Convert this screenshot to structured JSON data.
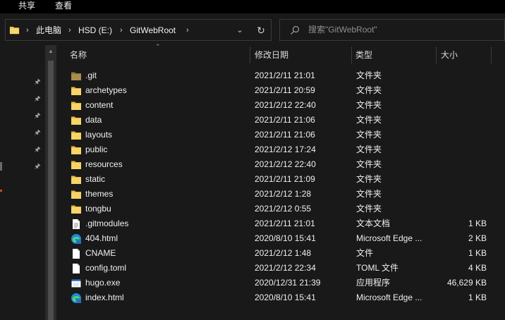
{
  "ribbon": {
    "tabs": [
      "共享",
      "查看"
    ]
  },
  "address": {
    "crumbs": [
      "此电脑",
      "HSD (E:)",
      "GitWebRoot"
    ],
    "separator": "›",
    "dropdown_icon": "chevron-down-icon",
    "refresh_icon": "refresh-icon"
  },
  "search": {
    "placeholder": "搜索\"GitWebRoot\""
  },
  "columns": {
    "name": "名称",
    "date": "修改日期",
    "type": "类型",
    "size": "大小"
  },
  "colors": {
    "folder": "#f0c24a",
    "accent_edge": "#d04a2a",
    "background": "#191919"
  },
  "files": [
    {
      "name": ".git",
      "date": "2021/2/11 21:01",
      "type": "文件夹",
      "size": "",
      "icon": "folder-icon-hidden"
    },
    {
      "name": "archetypes",
      "date": "2021/2/11 20:59",
      "type": "文件夹",
      "size": "",
      "icon": "folder-icon"
    },
    {
      "name": "content",
      "date": "2021/2/12 22:40",
      "type": "文件夹",
      "size": "",
      "icon": "folder-icon"
    },
    {
      "name": "data",
      "date": "2021/2/11 21:06",
      "type": "文件夹",
      "size": "",
      "icon": "folder-icon"
    },
    {
      "name": "layouts",
      "date": "2021/2/11 21:06",
      "type": "文件夹",
      "size": "",
      "icon": "folder-icon"
    },
    {
      "name": "public",
      "date": "2021/2/12 17:24",
      "type": "文件夹",
      "size": "",
      "icon": "folder-icon"
    },
    {
      "name": "resources",
      "date": "2021/2/12 22:40",
      "type": "文件夹",
      "size": "",
      "icon": "folder-icon"
    },
    {
      "name": "static",
      "date": "2021/2/11 21:09",
      "type": "文件夹",
      "size": "",
      "icon": "folder-icon"
    },
    {
      "name": "themes",
      "date": "2021/2/12 1:28",
      "type": "文件夹",
      "size": "",
      "icon": "folder-icon"
    },
    {
      "name": "tongbu",
      "date": "2021/2/12 0:55",
      "type": "文件夹",
      "size": "",
      "icon": "folder-icon"
    },
    {
      "name": ".gitmodules",
      "date": "2021/2/11 21:01",
      "type": "文本文档",
      "size": "1 KB",
      "icon": "text-file-icon"
    },
    {
      "name": "404.html",
      "date": "2020/8/10 15:41",
      "type": "Microsoft Edge ...",
      "size": "2 KB",
      "icon": "edge-html-icon"
    },
    {
      "name": "CNAME",
      "date": "2021/2/12 1:48",
      "type": "文件",
      "size": "1 KB",
      "icon": "blank-file-icon"
    },
    {
      "name": "config.toml",
      "date": "2021/2/12 22:34",
      "type": "TOML 文件",
      "size": "4 KB",
      "icon": "blank-file-icon"
    },
    {
      "name": "hugo.exe",
      "date": "2020/12/31 21:39",
      "type": "应用程序",
      "size": "46,629 KB",
      "icon": "exe-file-icon"
    },
    {
      "name": "index.html",
      "date": "2020/8/10 15:41",
      "type": "Microsoft Edge ...",
      "size": "1 KB",
      "icon": "edge-html-icon"
    }
  ]
}
